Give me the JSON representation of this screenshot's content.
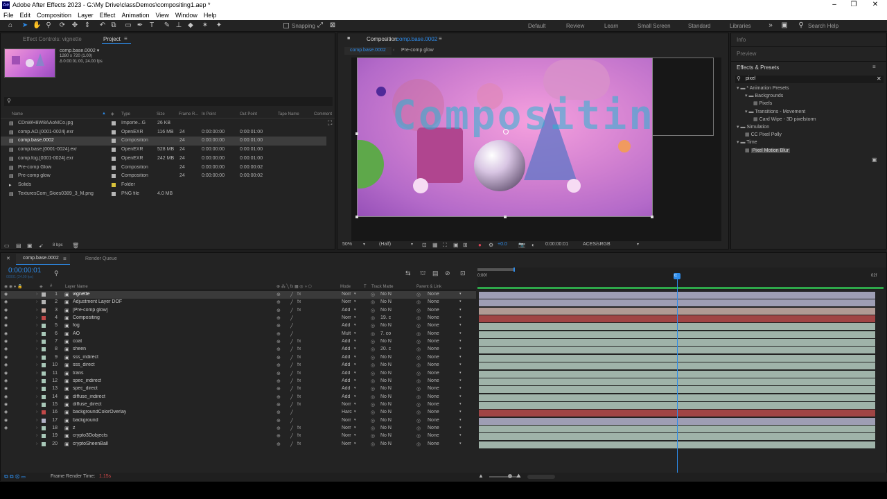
{
  "window": {
    "title": "Adobe After Effects 2023 - G:\\My Drive\\classDemos\\compositing1.aep *",
    "app_icon": "Ae"
  },
  "menu": [
    "File",
    "Edit",
    "Composition",
    "Layer",
    "Effect",
    "Animation",
    "View",
    "Window",
    "Help"
  ],
  "toolbar": {
    "snapping": "Snapping",
    "workspaces": [
      "Default",
      "Review",
      "Learn",
      "Small Screen",
      "Standard",
      "Libraries"
    ],
    "search_placeholder": "Search Help"
  },
  "project_panel": {
    "tabs": [
      "Effect Controls: vignette",
      "Project"
    ],
    "thumb_name": "comp.base.0002 ▾",
    "thumb_info1": "1280 x 720 (1.00)",
    "thumb_info2": "Δ 0:00:01:00, 24.00 fps",
    "columns": [
      "Name",
      "Type",
      "Size",
      "Frame R...",
      "In Point",
      "Out Point",
      "Tape Name",
      "Comment"
    ],
    "bpc": "8 bpc",
    "items": [
      {
        "name": "CDnWH8W8AAoMCo.jpg",
        "type": "Importe...G",
        "size": "26 KB",
        "fr": "",
        "in": "",
        "out": "",
        "color": "#b6b6b6"
      },
      {
        "name": "comp.AO.[0001-0024].exr",
        "type": "OpenEXR",
        "size": "116 MB",
        "fr": "24",
        "in": "0:00:00:00",
        "out": "0:00:01:00",
        "color": "#b6b6b6"
      },
      {
        "name": "comp.base.0002",
        "type": "Composition",
        "size": "",
        "fr": "24",
        "in": "0:00:00:00",
        "out": "0:00:01:00",
        "color": "#b6b6b6"
      },
      {
        "name": "comp.base.[0001-0024].exr",
        "type": "OpenEXR",
        "size": "528 MB",
        "fr": "24",
        "in": "0:00:00:00",
        "out": "0:00:01:00",
        "color": "#b6b6b6"
      },
      {
        "name": "comp.fog.[0001-0024].exr",
        "type": "OpenEXR",
        "size": "242 MB",
        "fr": "24",
        "in": "0:00:00:00",
        "out": "0:00:01:00",
        "color": "#b6b6b6"
      },
      {
        "name": "Pre-comp Glow",
        "type": "Composition",
        "size": "",
        "fr": "24",
        "in": "0:00:00:00",
        "out": "0:00:00:02",
        "color": "#b6b6b6"
      },
      {
        "name": "Pre-comp glow",
        "type": "Composition",
        "size": "",
        "fr": "24",
        "in": "0:00:00:00",
        "out": "0:00:00:02",
        "color": "#b6b6b6"
      },
      {
        "name": "Solids",
        "type": "Folder",
        "size": "",
        "fr": "",
        "in": "",
        "out": "",
        "color": "#d8c23a"
      },
      {
        "name": "TexturesCom_Skies0389_3_M.png",
        "type": "PNG file",
        "size": "4.0 MB",
        "fr": "",
        "in": "",
        "out": "",
        "color": "#b6b6b6"
      }
    ]
  },
  "comp_panel": {
    "tab": "Composition",
    "tab_name": "comp.base.0002",
    "breadcrumbs": [
      "comp.base.0002",
      "Pre-comp glow"
    ],
    "overlay_text": "Compositing",
    "zoom": "50%",
    "resolution": "(Half)",
    "exposure": "+0.0",
    "timecode": "0:00:00:01",
    "color_space": "ACES/sRGB"
  },
  "right_panel": {
    "sections": [
      "Info",
      "Preview",
      "Effects & Presets"
    ],
    "search_value": "pixel",
    "tree": [
      {
        "label": "* Animation Presets",
        "indent": 0,
        "type": "folder"
      },
      {
        "label": "Backgrounds",
        "indent": 1,
        "type": "folder"
      },
      {
        "label": "Pixels",
        "indent": 2,
        "type": "preset"
      },
      {
        "label": "Transitions - Movement",
        "indent": 1,
        "type": "folder"
      },
      {
        "label": "Card Wipe - 3D pixelstorm",
        "indent": 2,
        "type": "preset"
      },
      {
        "label": "Simulation",
        "indent": 0,
        "type": "folder"
      },
      {
        "label": "CC Pixel Polly",
        "indent": 1,
        "type": "effect"
      },
      {
        "label": "Time",
        "indent": 0,
        "type": "folder"
      },
      {
        "label": "Pixel Motion Blur",
        "indent": 1,
        "type": "effect"
      }
    ]
  },
  "timeline": {
    "tabs": [
      "comp.base.0002",
      "Render Queue"
    ],
    "timecode": "0:00:00:01",
    "timecode_sub": "00001 (24.00 fps)",
    "columns": [
      "Layer Name",
      "Mode",
      "T",
      "Track Matte",
      "Parent & Link"
    ],
    "ruler_start": "0:00f",
    "ruler_end": "02f",
    "playhead_label": "01",
    "footer_label": "Frame Render Time:",
    "footer_value": "1.15s",
    "layers": [
      {
        "num": "1",
        "name": "vignette",
        "color": "#b4b4b4",
        "mode": "Norr",
        "matte": "No N",
        "parent": "None",
        "bar": "#9e9eb4"
      },
      {
        "num": "2",
        "name": "Adjustment Layer DOF",
        "color": "#b4b4b4",
        "mode": "Norr",
        "matte": "No N",
        "parent": "None",
        "bar": "#9e9eb4"
      },
      {
        "num": "3",
        "name": "[Pre-comp glow]",
        "color": "#c9a9a0",
        "mode": "Add",
        "matte": "No N",
        "parent": "None",
        "bar": "#b09a94"
      },
      {
        "num": "4",
        "name": "Compositing",
        "color": "#c24848",
        "mode": "Norr",
        "matte": "19. c",
        "parent": "None",
        "bar": "#a04545"
      },
      {
        "num": "5",
        "name": "fog",
        "color": "#a8c8b8",
        "mode": "Add",
        "matte": "No N",
        "parent": "None",
        "bar": "#9fb3a9"
      },
      {
        "num": "6",
        "name": "AO",
        "color": "#a8c8b8",
        "mode": "Mult",
        "matte": "7. co",
        "parent": "None",
        "bar": "#9fb3a9"
      },
      {
        "num": "7",
        "name": "coat",
        "color": "#a8c8b8",
        "mode": "Add",
        "matte": "No N",
        "parent": "None",
        "bar": "#9fb3a9"
      },
      {
        "num": "8",
        "name": "sheen",
        "color": "#a8c8b8",
        "mode": "Add",
        "matte": "20. c",
        "parent": "None",
        "bar": "#9fb3a9"
      },
      {
        "num": "9",
        "name": "sss_indirect",
        "color": "#a8c8b8",
        "mode": "Add",
        "matte": "No N",
        "parent": "None",
        "bar": "#9fb3a9"
      },
      {
        "num": "10",
        "name": "sss_direct",
        "color": "#a8c8b8",
        "mode": "Add",
        "matte": "No N",
        "parent": "None",
        "bar": "#9fb3a9"
      },
      {
        "num": "11",
        "name": "trans",
        "color": "#a8c8b8",
        "mode": "Add",
        "matte": "No N",
        "parent": "None",
        "bar": "#9fb3a9"
      },
      {
        "num": "12",
        "name": "spec_indirect",
        "color": "#a8c8b8",
        "mode": "Add",
        "matte": "No N",
        "parent": "None",
        "bar": "#9fb3a9"
      },
      {
        "num": "13",
        "name": "spec_direct",
        "color": "#a8c8b8",
        "mode": "Add",
        "matte": "No N",
        "parent": "None",
        "bar": "#9fb3a9"
      },
      {
        "num": "14",
        "name": "diffuse_indirect",
        "color": "#a8c8b8",
        "mode": "Add",
        "matte": "No N",
        "parent": "None",
        "bar": "#9fb3a9"
      },
      {
        "num": "15",
        "name": "diffuse_direct",
        "color": "#a8c8b8",
        "mode": "Norr",
        "matte": "No N",
        "parent": "None",
        "bar": "#9fb3a9"
      },
      {
        "num": "16",
        "name": "backgroundColorOverlay",
        "color": "#c24848",
        "mode": "Harc",
        "matte": "No N",
        "parent": "None",
        "bar": "#a04545"
      },
      {
        "num": "17",
        "name": "background",
        "color": "#b4b4c8",
        "mode": "Norr",
        "matte": "No N",
        "parent": "None",
        "bar": "#9e9eb4"
      },
      {
        "num": "18",
        "name": "z",
        "color": "#a8c8b8",
        "mode": "Norr",
        "matte": "No N",
        "parent": "None",
        "bar": "#9fb3a9"
      },
      {
        "num": "19",
        "name": "crypto3Dobjects",
        "color": "#a8c8b8",
        "mode": "Norr",
        "matte": "No N",
        "parent": "None",
        "bar": "#9fb3a9"
      },
      {
        "num": "20",
        "name": "cryptoSheenBall",
        "color": "#a8c8b8",
        "mode": "Norr",
        "matte": "No N",
        "parent": "None",
        "bar": "#9fb3a9"
      }
    ]
  },
  "colors": {
    "accent": "#2d8ceb",
    "panel": "#232323",
    "selected": "#3d3d3d"
  }
}
